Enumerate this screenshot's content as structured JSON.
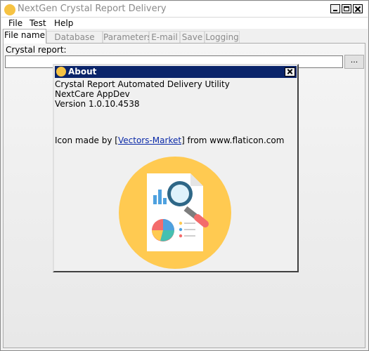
{
  "window": {
    "title": "NextGen Crystal Report Delivery"
  },
  "menu": [
    "File",
    "Test",
    "Help"
  ],
  "tabs": [
    "File name",
    "Database Info",
    "Parameters",
    "E-mail",
    "Save",
    "Logging"
  ],
  "active_tab": "File name",
  "file_tab": {
    "crystal_report_label": "Crystal report:",
    "crystal_report_value": "",
    "browse_label": "..."
  },
  "about_dialog": {
    "title": "About",
    "lines": [
      "Crystal Report Automated Delivery Utility",
      "NextCare AppDev",
      "Version 1.0.10.4538"
    ],
    "credit_prefix": "Icon made by [",
    "credit_link": "Vectors-Market",
    "credit_suffix": "] from www.flaticon.com"
  },
  "colors": {
    "dialog_title_bg": "#0a246a",
    "icon_circle": "#ffca51",
    "link": "#0b2aa8"
  },
  "icons": {
    "app": "crystal-report-icon",
    "illustration": "report-analysis-icon"
  }
}
